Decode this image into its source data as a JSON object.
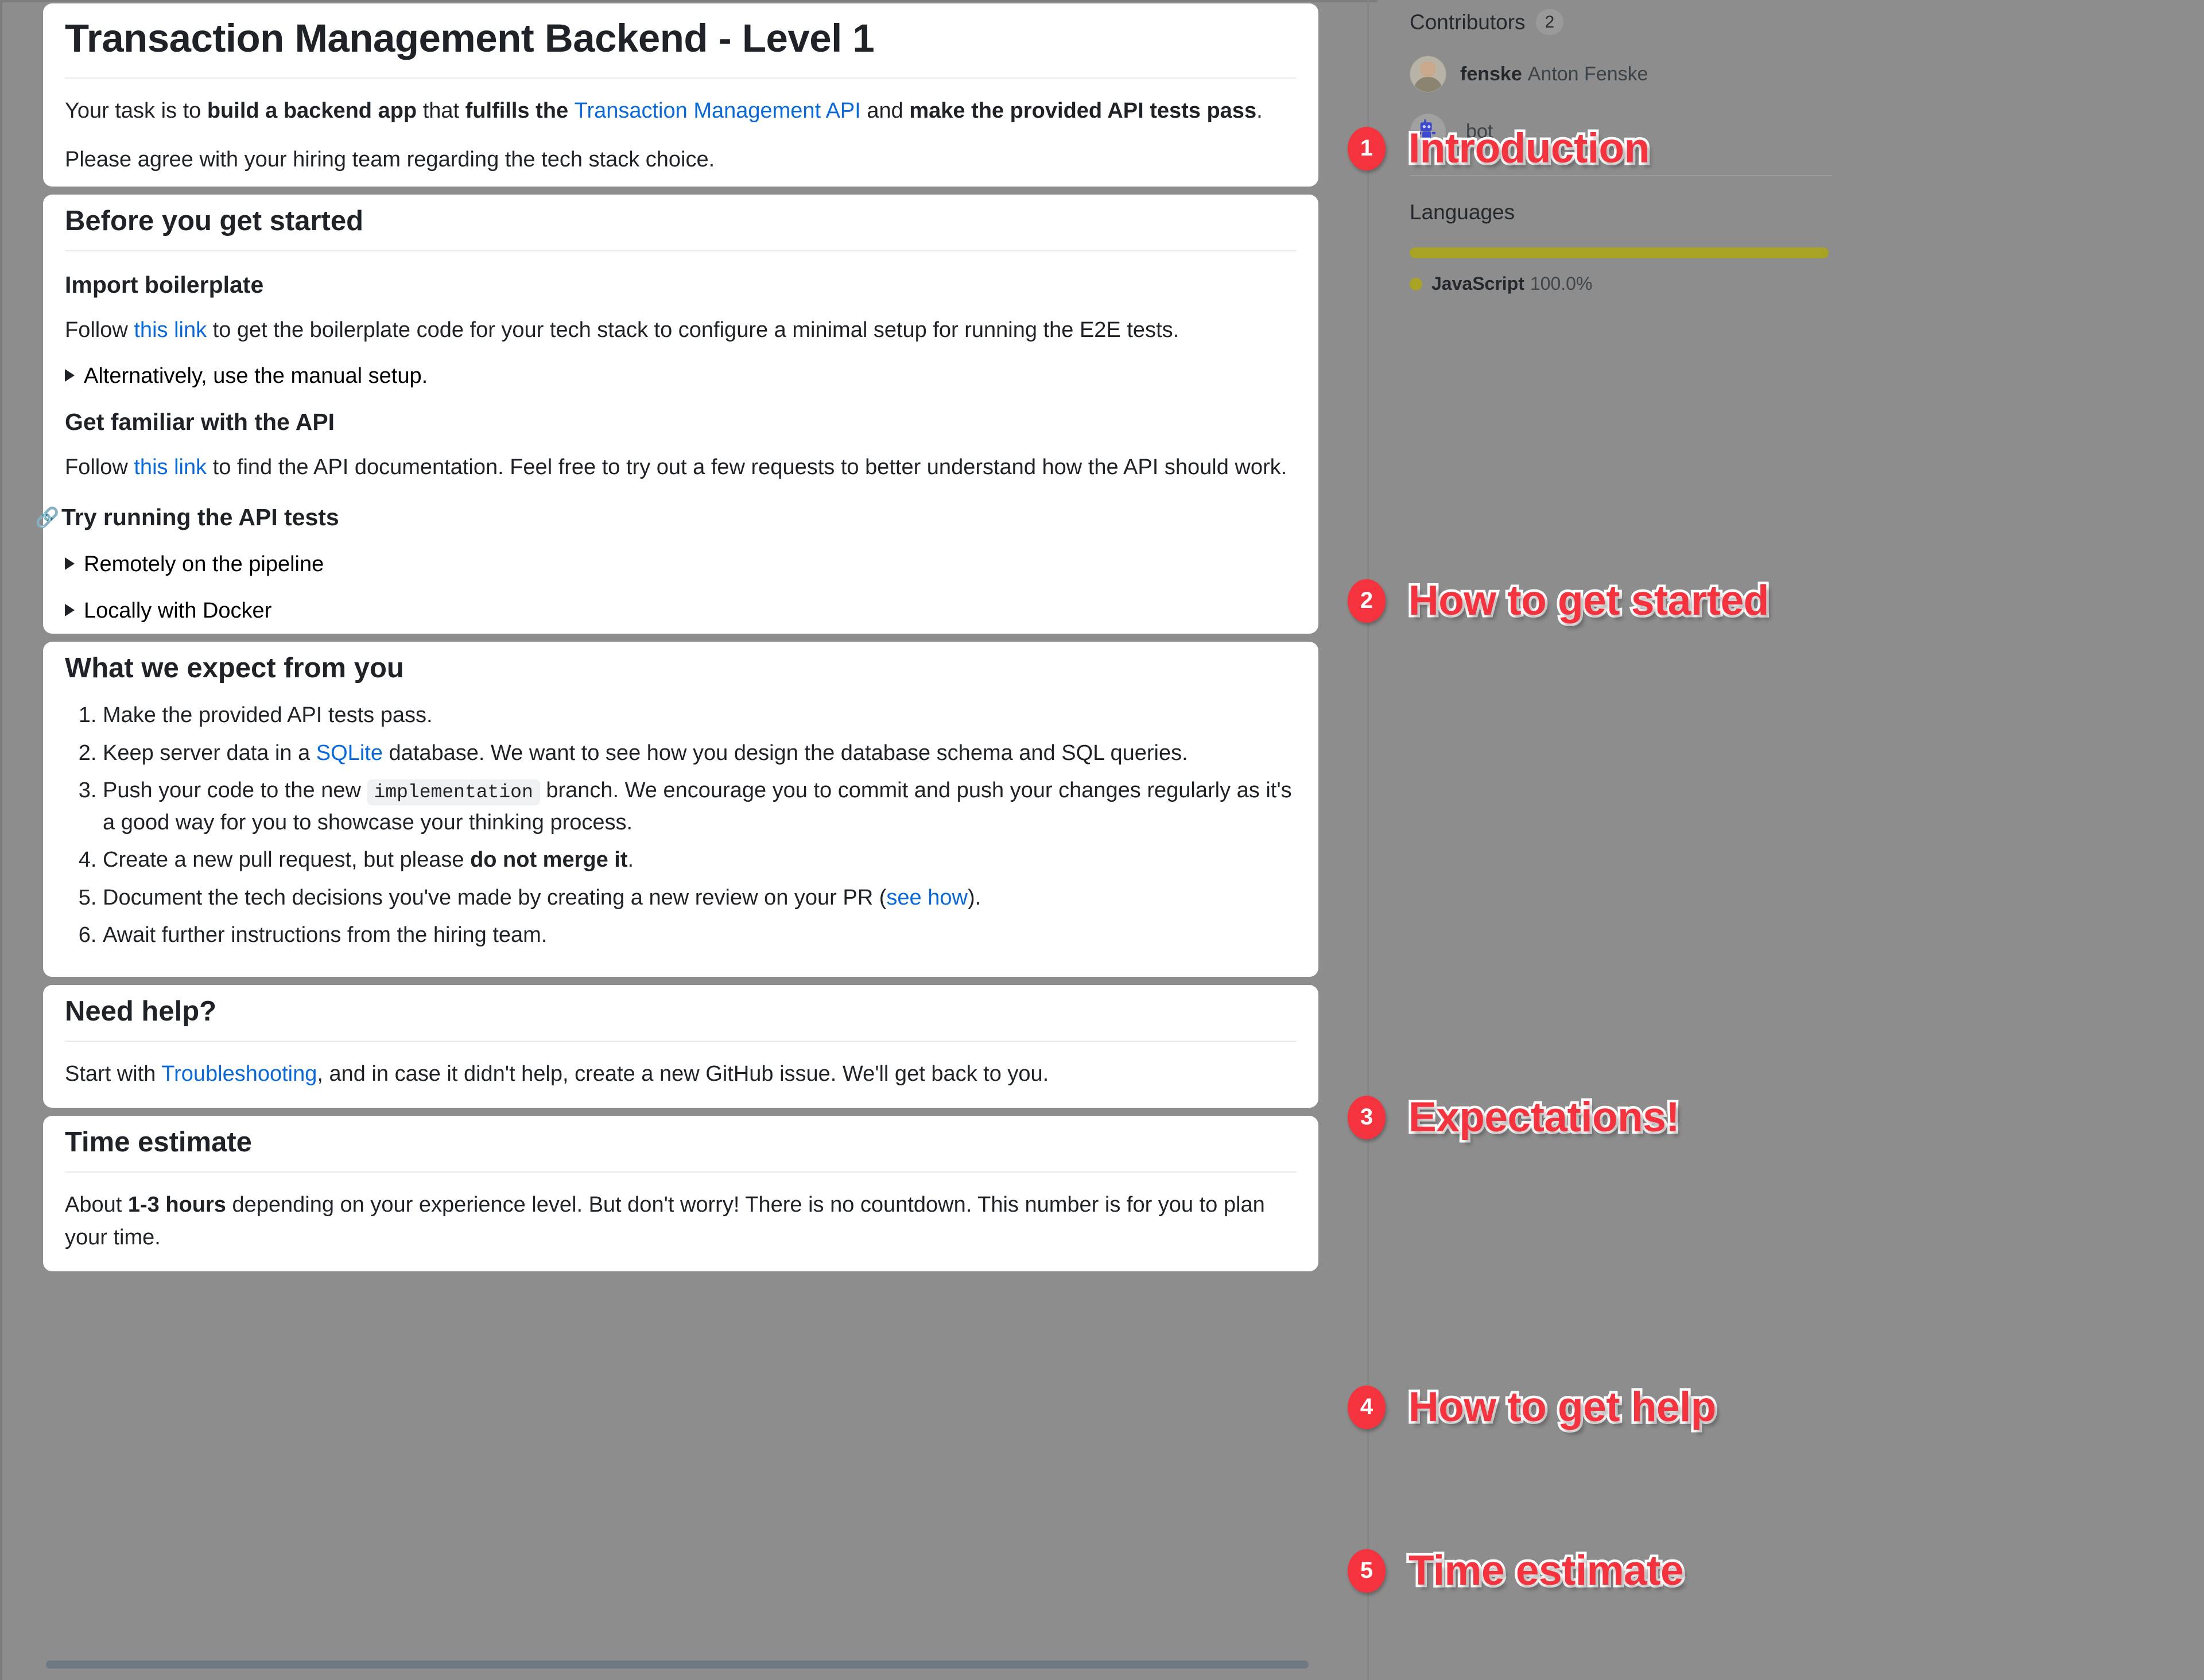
{
  "readme": {
    "intro_card": {
      "title": "Transaction Management Backend - Level 1",
      "p1_a": "Your task is to ",
      "p1_b": "build a backend app",
      "p1_c": " that ",
      "p1_d": "fulfills the ",
      "p1_link": "Transaction Management API",
      "p1_e": " and ",
      "p1_f": "make the provided API tests pass",
      "p1_g": ".",
      "p2": "Please agree with your hiring team regarding the tech stack choice."
    },
    "before_card": {
      "title": "Before you get started",
      "sub1": "Import boilerplate",
      "sub1_p_a": "Follow ",
      "sub1_link": "this link",
      "sub1_p_b": " to get the boilerplate code for your tech stack to configure a minimal setup for running the E2E tests.",
      "sub1_details": "Alternatively, use the manual setup.",
      "sub2": "Get familiar with the API",
      "sub2_p_a": "Follow ",
      "sub2_link": "this link",
      "sub2_p_b": " to find the API documentation. Feel free to try out a few requests to better understand how the API should work.",
      "sub3": "Try running the API tests",
      "sub3_anchor_icon": "link-icon",
      "sub3_details_1": "Remotely on the pipeline",
      "sub3_details_2": "Locally with Docker"
    },
    "expect_card": {
      "title": "What we expect from you",
      "items": [
        {
          "plain": "Make the provided API tests pass."
        },
        {
          "a": "Keep server data in a ",
          "link": "SQLite",
          "b": " database. We want to see how you design the database schema and SQL queries."
        },
        {
          "a": "Push your code to the new ",
          "code": "implementation",
          "b": " branch. We encourage you to commit and push your changes regularly as it's a good way for you to showcase your thinking process."
        },
        {
          "a": "Create a new pull request, but please ",
          "bold": "do not merge it",
          "b": "."
        },
        {
          "a": "Document the tech decisions you've made by creating a new review on your PR (",
          "link": "see how",
          "b": ")."
        },
        {
          "plain": "Await further instructions from the hiring team."
        }
      ]
    },
    "help_card": {
      "title": "Need help?",
      "p_a": "Start with ",
      "link": "Troubleshooting",
      "p_b": ", and in case it didn't help, create a new GitHub issue. We'll get back to you."
    },
    "time_card": {
      "title": "Time estimate",
      "p_a": "About ",
      "bold": "1-3 hours",
      "p_b": " depending on your experience level. But don't worry! There is no countdown. This number is for you to plan your time."
    }
  },
  "sidebar": {
    "contributors_label": "Contributors",
    "contributors_count": "2",
    "contributors": [
      {
        "username": "fenske",
        "fullname": "Anton Fenske",
        "avatar": "person-avatar"
      },
      {
        "username": "",
        "fullname": "bot",
        "avatar": "robot-avatar"
      }
    ],
    "languages_label": "Languages",
    "languages": [
      {
        "name": "JavaScript",
        "percent": "100.0%",
        "color": "#a8a325",
        "width": "100%"
      }
    ]
  },
  "annotations": [
    {
      "number": "1",
      "text": "Introduction"
    },
    {
      "number": "2",
      "text": "How to get started"
    },
    {
      "number": "3",
      "text": "Expectations!"
    },
    {
      "number": "4",
      "text": "How to get help"
    },
    {
      "number": "5",
      "text": "Time estimate"
    }
  ],
  "colors": {
    "page_bg": "#8d8d8d",
    "card_bg": "#ffffff",
    "link": "#0969da",
    "annotation_red": "#f5333f"
  }
}
